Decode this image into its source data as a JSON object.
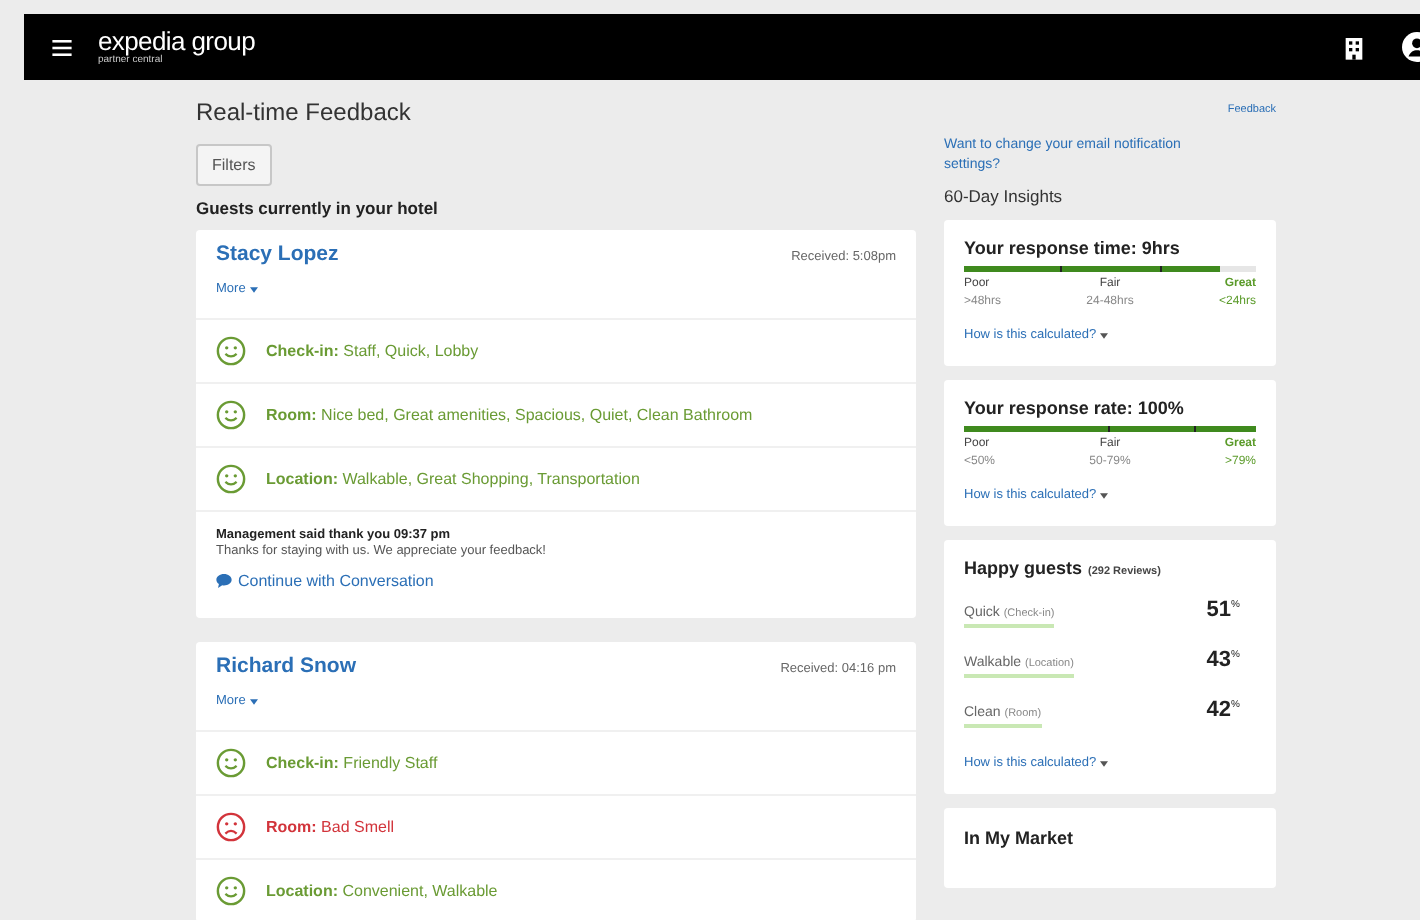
{
  "header": {
    "logo": "expedia group",
    "logo_subtitle": "partner central"
  },
  "page": {
    "title": "Real-time Feedback",
    "filters_button": "Filters",
    "section_heading": "Guests currently in your hotel"
  },
  "guests": [
    {
      "name": "Stacy Lopez",
      "received": "Received: 5:08pm",
      "more": "More",
      "feedback": [
        {
          "happy": true,
          "label": "Check-in:",
          "text": "Staff, Quick, Lobby"
        },
        {
          "happy": true,
          "label": "Room:",
          "text": "Nice bed, Great amenities, Spacious, Quiet, Clean Bathroom"
        },
        {
          "happy": true,
          "label": "Location:",
          "text": "Walkable, Great Shopping, Transportation"
        }
      ],
      "management": {
        "heading": "Management said thank you 09:37 pm",
        "message": "Thanks for staying with us. We appreciate your feedback!",
        "link": "Continue with Conversation"
      }
    },
    {
      "name": "Richard Snow",
      "received": "Received: 04:16 pm",
      "more": "More",
      "feedback": [
        {
          "happy": true,
          "label": "Check-in:",
          "text": "Friendly Staff"
        },
        {
          "happy": false,
          "label": "Room:",
          "text": "Bad Smell"
        },
        {
          "happy": true,
          "label": "Location:",
          "text": "Convenient, Walkable"
        }
      ]
    }
  ],
  "sidebar": {
    "feedback_link": "Feedback",
    "notification_link": "Want to change your email notification settings?",
    "insights_heading": "60-Day Insights",
    "meters": [
      {
        "title": "Your response time: 9hrs",
        "level": 0.88,
        "ranges": [
          {
            "name": "Poor",
            "value": ">48hrs",
            "highlighted": false
          },
          {
            "name": "Fair",
            "value": "24-48hrs",
            "highlighted": false
          },
          {
            "name": "Great",
            "value": "<24hrs",
            "highlighted": true
          }
        ],
        "link": "How is this calculated?"
      },
      {
        "title": "Your response rate: 100%",
        "level": 1,
        "ranges": [
          {
            "name": "Poor",
            "value": "<50%",
            "highlighted": false
          },
          {
            "name": "Fair",
            "value": "50-79%",
            "highlighted": false
          },
          {
            "name": "Great",
            "value": ">79%",
            "highlighted": true
          }
        ],
        "link": "How is this calculated?"
      }
    ],
    "happy": {
      "title": "Happy guests",
      "count": "(292 Reviews)",
      "items": [
        {
          "label": "Quick",
          "category": "(Check-in)",
          "value": "51",
          "unit": "%"
        },
        {
          "label": "Walkable",
          "category": "(Location)",
          "value": "43",
          "unit": "%"
        },
        {
          "label": "Clean",
          "category": "(Room)",
          "value": "42",
          "unit": "%"
        }
      ],
      "link": "How is this calculated?"
    },
    "market": {
      "title": "In My Market"
    }
  }
}
